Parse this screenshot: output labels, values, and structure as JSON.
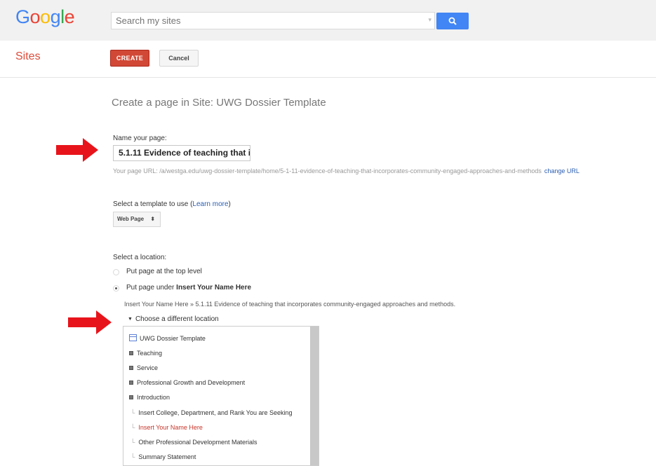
{
  "header": {
    "logo": {
      "letters": [
        "G",
        "o",
        "o",
        "g",
        "l",
        "e"
      ],
      "colors": [
        "#4285f4",
        "#ea4335",
        "#fbbc05",
        "#4285f4",
        "#34a853",
        "#ea4335"
      ]
    },
    "search": {
      "placeholder": "Search my sites"
    }
  },
  "subheader": {
    "app_title": "Sites",
    "create_label": "CREATE",
    "cancel_label": "Cancel"
  },
  "form": {
    "page_title": "Create a page in Site: UWG Dossier Template",
    "name_label": "Name your page:",
    "name_value": "5.1.11 Evidence of teaching that incorporates community-engaged approaches and methods",
    "url_prefix": "Your page URL: /a/westga.edu/uwg-dossier-template/home/5-1-11-evidence-of-teaching-that-incorporates-community-engaged-approaches-and-methods",
    "change_url": "change URL",
    "template_label": "Select a template to use (",
    "learn_more": "Learn more",
    "template_label_end": ")",
    "template_value": "Web Page",
    "location_label": "Select a location:",
    "option_top": "Put page at the top level",
    "option_under_prefix": "Put page under ",
    "option_under_name": "Insert Your Name Here",
    "path_text": "Insert Your Name Here » 5.1.11 Evidence of teaching that incorporates community-engaged approaches and methods.",
    "choose_location": "Choose a different location"
  },
  "tree": {
    "root": "UWG Dossier Template",
    "items": [
      "Teaching",
      "Service",
      "Professional Growth and Development",
      "Introduction",
      "Insert College, Department, and Rank You are Seeking",
      "Insert Your Name Here",
      "Other Professional Development Materials",
      "Summary Statement"
    ]
  },
  "colors": {
    "accent_red": "#d14836",
    "search_blue": "#4285f4",
    "link_blue": "#2a5db0",
    "annotation_arrow": "#e8141b"
  }
}
